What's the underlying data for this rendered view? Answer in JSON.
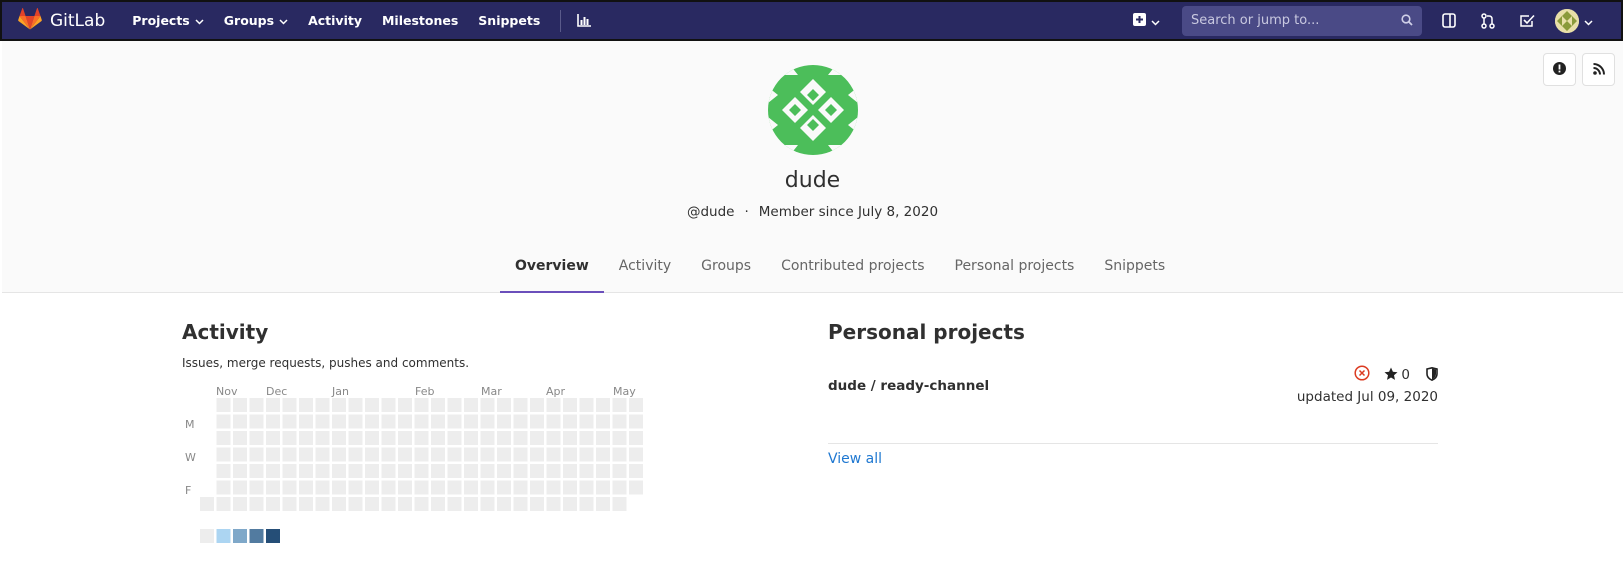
{
  "navbar": {
    "brand": "GitLab",
    "links": [
      {
        "label": "Projects",
        "dropdown": true
      },
      {
        "label": "Groups",
        "dropdown": true
      },
      {
        "label": "Activity",
        "dropdown": false
      },
      {
        "label": "Milestones",
        "dropdown": false
      },
      {
        "label": "Snippets",
        "dropdown": false
      }
    ],
    "search_placeholder": "Search or jump to...",
    "colors": {
      "bar": "#292961",
      "accent": "#fc6d26"
    }
  },
  "profile": {
    "name": "dude",
    "username": "@dude",
    "separator": "·",
    "member_since": "Member since July 8, 2020",
    "tabs": [
      "Overview",
      "Activity",
      "Groups",
      "Contributed projects",
      "Personal projects",
      "Snippets"
    ],
    "active_tab": "Overview"
  },
  "activity": {
    "title": "Activity",
    "description": "Issues, merge requests, pushes and comments.",
    "months": [
      "Nov",
      "Dec",
      "Jan",
      "Feb",
      "Mar",
      "Apr",
      "May"
    ],
    "day_labels": [
      "M",
      "W",
      "F"
    ],
    "legend_colors": [
      "#ededed",
      "#acd5f2",
      "#7fa8c9",
      "#527ba0",
      "#254e77"
    ]
  },
  "personal_projects": {
    "title": "Personal projects",
    "items": [
      {
        "name": "dude / ready-channel",
        "stars": "0",
        "updated": "updated Jul 09, 2020"
      }
    ],
    "view_all": "View all"
  }
}
